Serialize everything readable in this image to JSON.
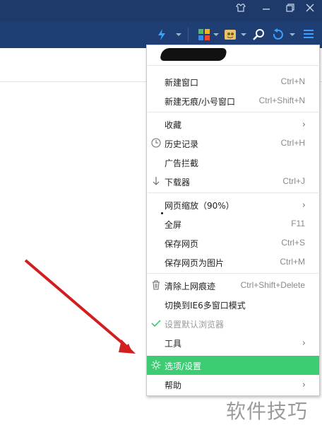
{
  "menu": {
    "items": [
      {
        "label": "新建窗口",
        "shortcut": "Ctrl+N"
      },
      {
        "label": "新建无痕/小号窗口",
        "shortcut": "Ctrl+Shift+N"
      },
      {
        "label": "收藏",
        "submenu": "›"
      },
      {
        "label": "历史记录",
        "shortcut": "Ctrl+H",
        "icon": "clock-icon"
      },
      {
        "label": "广告拦截"
      },
      {
        "label": "下载器",
        "shortcut": "Ctrl+J",
        "icon": "download-arrow-icon"
      },
      {
        "label": "网页缩放（90%）",
        "submenu": "›"
      },
      {
        "label": "全屏",
        "shortcut": "F11"
      },
      {
        "label": "保存网页",
        "shortcut": "Ctrl+S"
      },
      {
        "label": "保存网页为图片",
        "shortcut": "Ctrl+M"
      },
      {
        "label": "清除上网痕迹",
        "shortcut": "Ctrl+Shift+Delete",
        "icon": "trash-icon"
      },
      {
        "label": "切换到IE6多窗口模式"
      },
      {
        "label": "设置默认浏览器",
        "icon": "check-icon"
      },
      {
        "label": "工具",
        "submenu": "›"
      },
      {
        "label": "选项/设置",
        "icon": "gear-icon",
        "highlighted": true
      },
      {
        "label": "帮助",
        "submenu": "›"
      }
    ]
  },
  "watermark": "软件技巧",
  "colors": {
    "titlebar": "#1d3a6b",
    "toolbar": "#1f3f74",
    "highlight": "#3dcc74",
    "arrow": "#d11f1f"
  }
}
